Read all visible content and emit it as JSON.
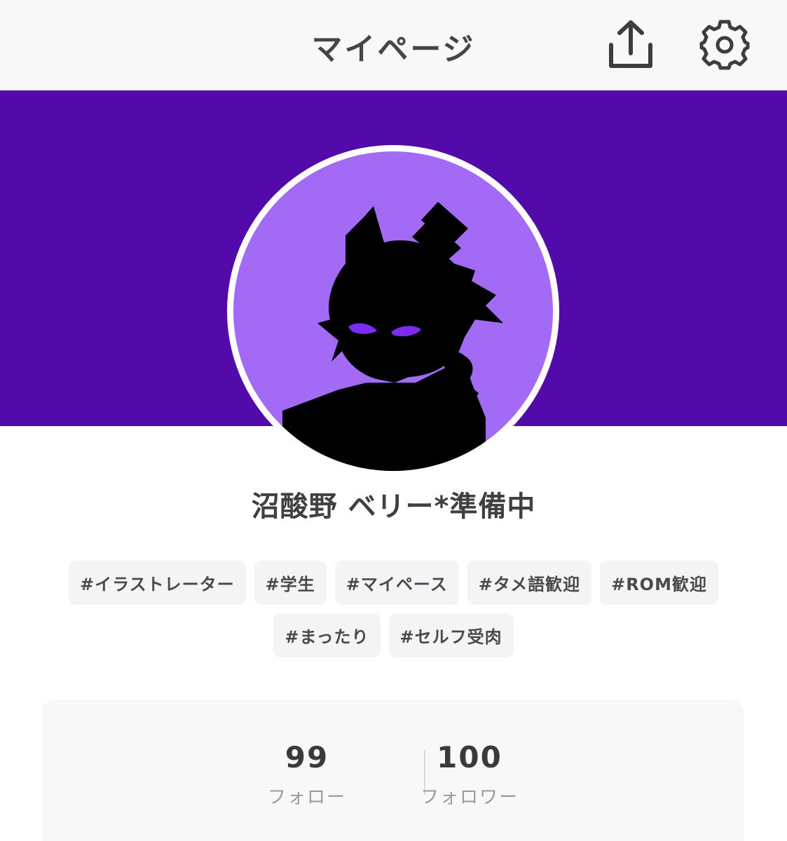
{
  "header": {
    "title": "マイページ",
    "share_icon": "share-upload-icon",
    "settings_icon": "gear-icon"
  },
  "colors": {
    "banner": "#520aaa",
    "avatar_bg": "#a36bf5",
    "eyes": "#7b2cf0"
  },
  "profile": {
    "name": "沼酸野 ベリー*準備中",
    "avatar_description_icon": "silhouette-avatar"
  },
  "tags": {
    "row1": [
      "#イラストレーター",
      "#学生",
      "#マイペース",
      "#タメ語歓迎",
      "#ROM歓迎"
    ],
    "row2": [
      "#まったり",
      "#セルフ受肉"
    ]
  },
  "stats": {
    "follow_count": "99",
    "follow_label": "フォロー",
    "follower_count": "100",
    "follower_label": "フォロワー"
  }
}
